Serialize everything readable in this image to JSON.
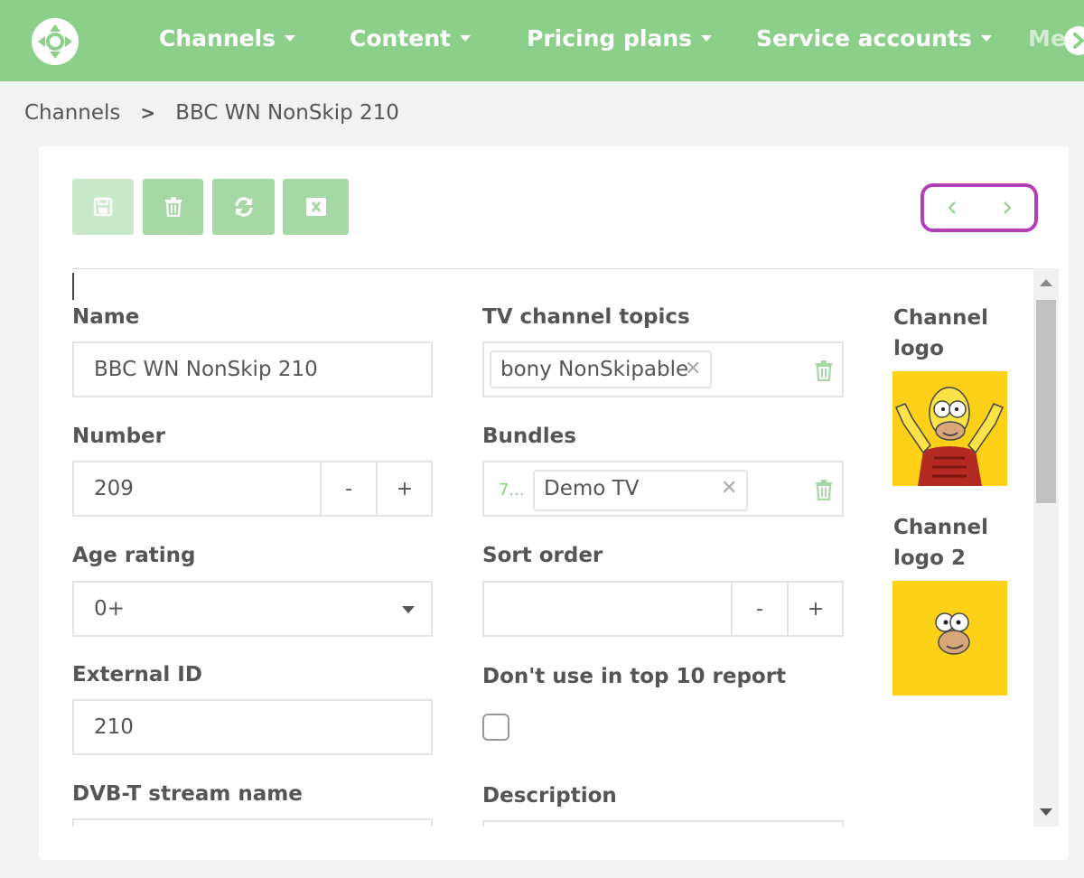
{
  "colors": {
    "nav_bg": "#8ccf8b",
    "accent": "#a6d8a5",
    "pager_highlight": "#b03fb8",
    "logo_bg": "#fcd117"
  },
  "nav": {
    "logo_icon": "navigation-compass-icon",
    "items": [
      {
        "label": "Channels"
      },
      {
        "label": "Content"
      },
      {
        "label": "Pricing plans"
      },
      {
        "label": "Service accounts"
      }
    ],
    "more_label": "Me",
    "scroll_icon": "chevron-right-icon"
  },
  "breadcrumb": {
    "root": "Channels",
    "separator": ">",
    "current": "BBC WN NonSkip 210"
  },
  "toolbar": {
    "save_icon": "save-icon",
    "delete_icon": "trash-icon",
    "refresh_icon": "refresh-icon",
    "close_icon": "close-box-icon"
  },
  "pager": {
    "prev_icon": "chevron-left-icon",
    "next_icon": "chevron-right-icon"
  },
  "form": {
    "name": {
      "label": "Name",
      "value": "BBC WN NonSkip 210"
    },
    "number": {
      "label": "Number",
      "value": "209",
      "minus": "-",
      "plus": "+"
    },
    "age_rating": {
      "label": "Age rating",
      "value": "0+"
    },
    "external_id": {
      "label": "External ID",
      "value": "210"
    },
    "dvbt_stream_name": {
      "label": "DVB-T stream name",
      "value": ""
    },
    "tv_channel_topics": {
      "label": "TV channel topics",
      "tags": [
        "bony NonSkipable"
      ]
    },
    "bundles": {
      "label": "Bundles",
      "prefix": "7...",
      "tags": [
        "Demo TV"
      ]
    },
    "sort_order": {
      "label": "Sort order",
      "value": "",
      "minus": "-",
      "plus": "+"
    },
    "top10": {
      "label": "Don't use in top 10 report",
      "checked": false
    },
    "description": {
      "label": "Description",
      "value": ""
    },
    "channel_logo": {
      "label": "Channel logo"
    },
    "channel_logo_2": {
      "label": "Channel logo 2"
    }
  }
}
